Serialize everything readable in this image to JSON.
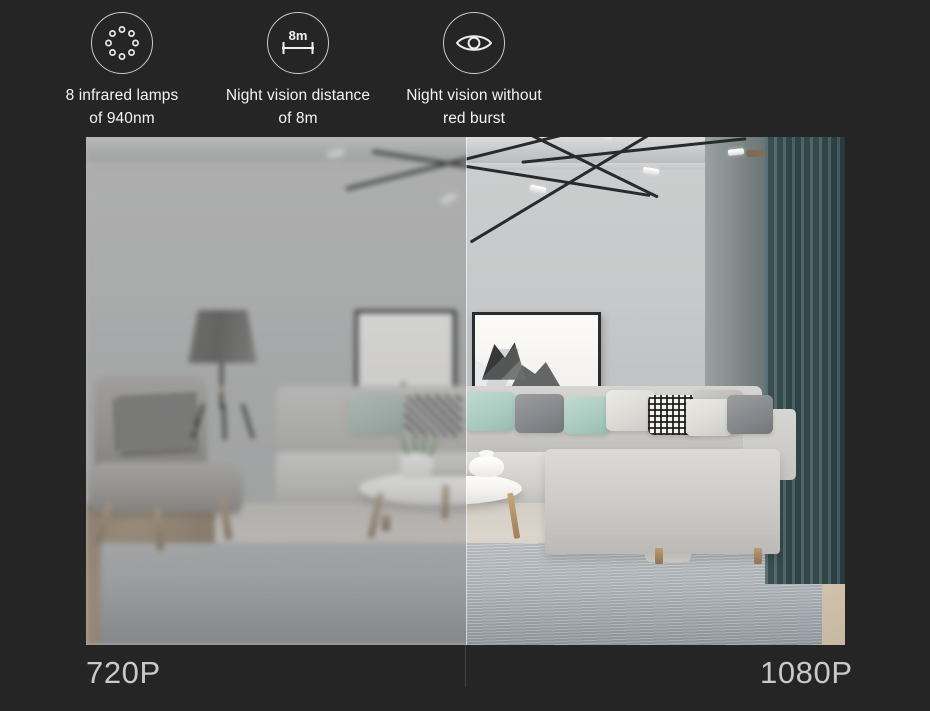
{
  "background_color": "#252525",
  "features": [
    {
      "icon": "infrared-lamp-ring-icon",
      "line1": "8 infrared lamps",
      "line2": "of 940nm"
    },
    {
      "icon": "distance-ruler-icon",
      "icon_text": "8m",
      "line1": "Night vision distance",
      "line2": "of 8m"
    },
    {
      "icon": "eye-icon",
      "line1": "Night vision without",
      "line2": "red burst"
    }
  ],
  "comparison": {
    "left_caption": "720P",
    "right_caption": "1080P",
    "left_quality": "blurred-low-resolution",
    "right_quality": "sharp-high-resolution",
    "scene": "living-room-night-vision-preview",
    "text_color": "#c9c9c9",
    "accent_color": "#f4f4f4"
  }
}
